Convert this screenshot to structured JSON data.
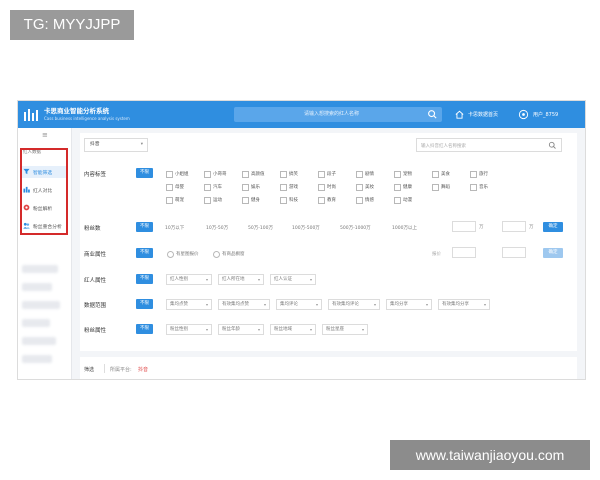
{
  "watermarks": {
    "top_left": "TG: MYYJJPP",
    "bottom_right": "www.taiwanjiaoyou.com"
  },
  "header": {
    "title": "卡思商业智能分析系统",
    "subtitle": "Cass business intelligence analysis system",
    "search_placeholder": "请输入想搜索的红人名称",
    "home_link": "卡思数据首页",
    "user_label": "用户_8759"
  },
  "sidebar": {
    "group_label": "红人数据",
    "items": [
      {
        "label": "智能筛选",
        "icon": "filter-icon",
        "active": true
      },
      {
        "label": "红人对比",
        "icon": "compare-icon",
        "active": false
      },
      {
        "label": "粉丝解析",
        "icon": "fans-analysis-icon",
        "active": false
      },
      {
        "label": "粉丝重合分析",
        "icon": "overlap-analysis-icon",
        "active": false
      }
    ]
  },
  "filters": {
    "platform": "抖音",
    "keyword_placeholder": "输入抖音红人名称搜索",
    "any_label": "不限",
    "content": {
      "label": "内容标签",
      "row1": [
        "小姐姐",
        "小哥哥",
        "高颜值",
        "搞笑",
        "段子",
        "剧情",
        "宠物",
        "美食",
        "旅行"
      ],
      "row2": [
        "母婴",
        "汽车",
        "娱乐",
        "游戏",
        "时尚",
        "美妆",
        "健康",
        "舞蹈",
        "音乐"
      ],
      "row3": [
        "萌宠",
        "运动",
        "健身",
        "科技",
        "教育",
        "情感",
        "动漫"
      ]
    },
    "fans": {
      "label": "粉丝数",
      "ranges": [
        "10万以下",
        "10万-50万",
        "50万-100万",
        "100万-500万",
        "500万-1000万",
        "1000万以上"
      ],
      "unit": "万",
      "confirm": "确定"
    },
    "commerce": {
      "label": "商业属性",
      "options": [
        "有星图报价",
        "有商品橱窗"
      ],
      "price_label": "报价",
      "confirm": "确定"
    },
    "kol": {
      "label": "红人属性",
      "selects": [
        "红人性别",
        "红人所在地",
        "红人认证"
      ]
    },
    "data_range": {
      "label": "数据范围",
      "selects": [
        "集均点赞",
        "有效集均点赞",
        "集均评论",
        "有效集均评论",
        "集均分享",
        "有效集均分享"
      ]
    },
    "fans_attr": {
      "label": "粉丝属性",
      "selects": [
        "粉丝性别",
        "粉丝年龄",
        "粉丝地域",
        "粉丝星座"
      ]
    }
  },
  "footer_bar": {
    "label": "筛选",
    "platform_label": "所属平台:",
    "platform_value": "抖音"
  }
}
